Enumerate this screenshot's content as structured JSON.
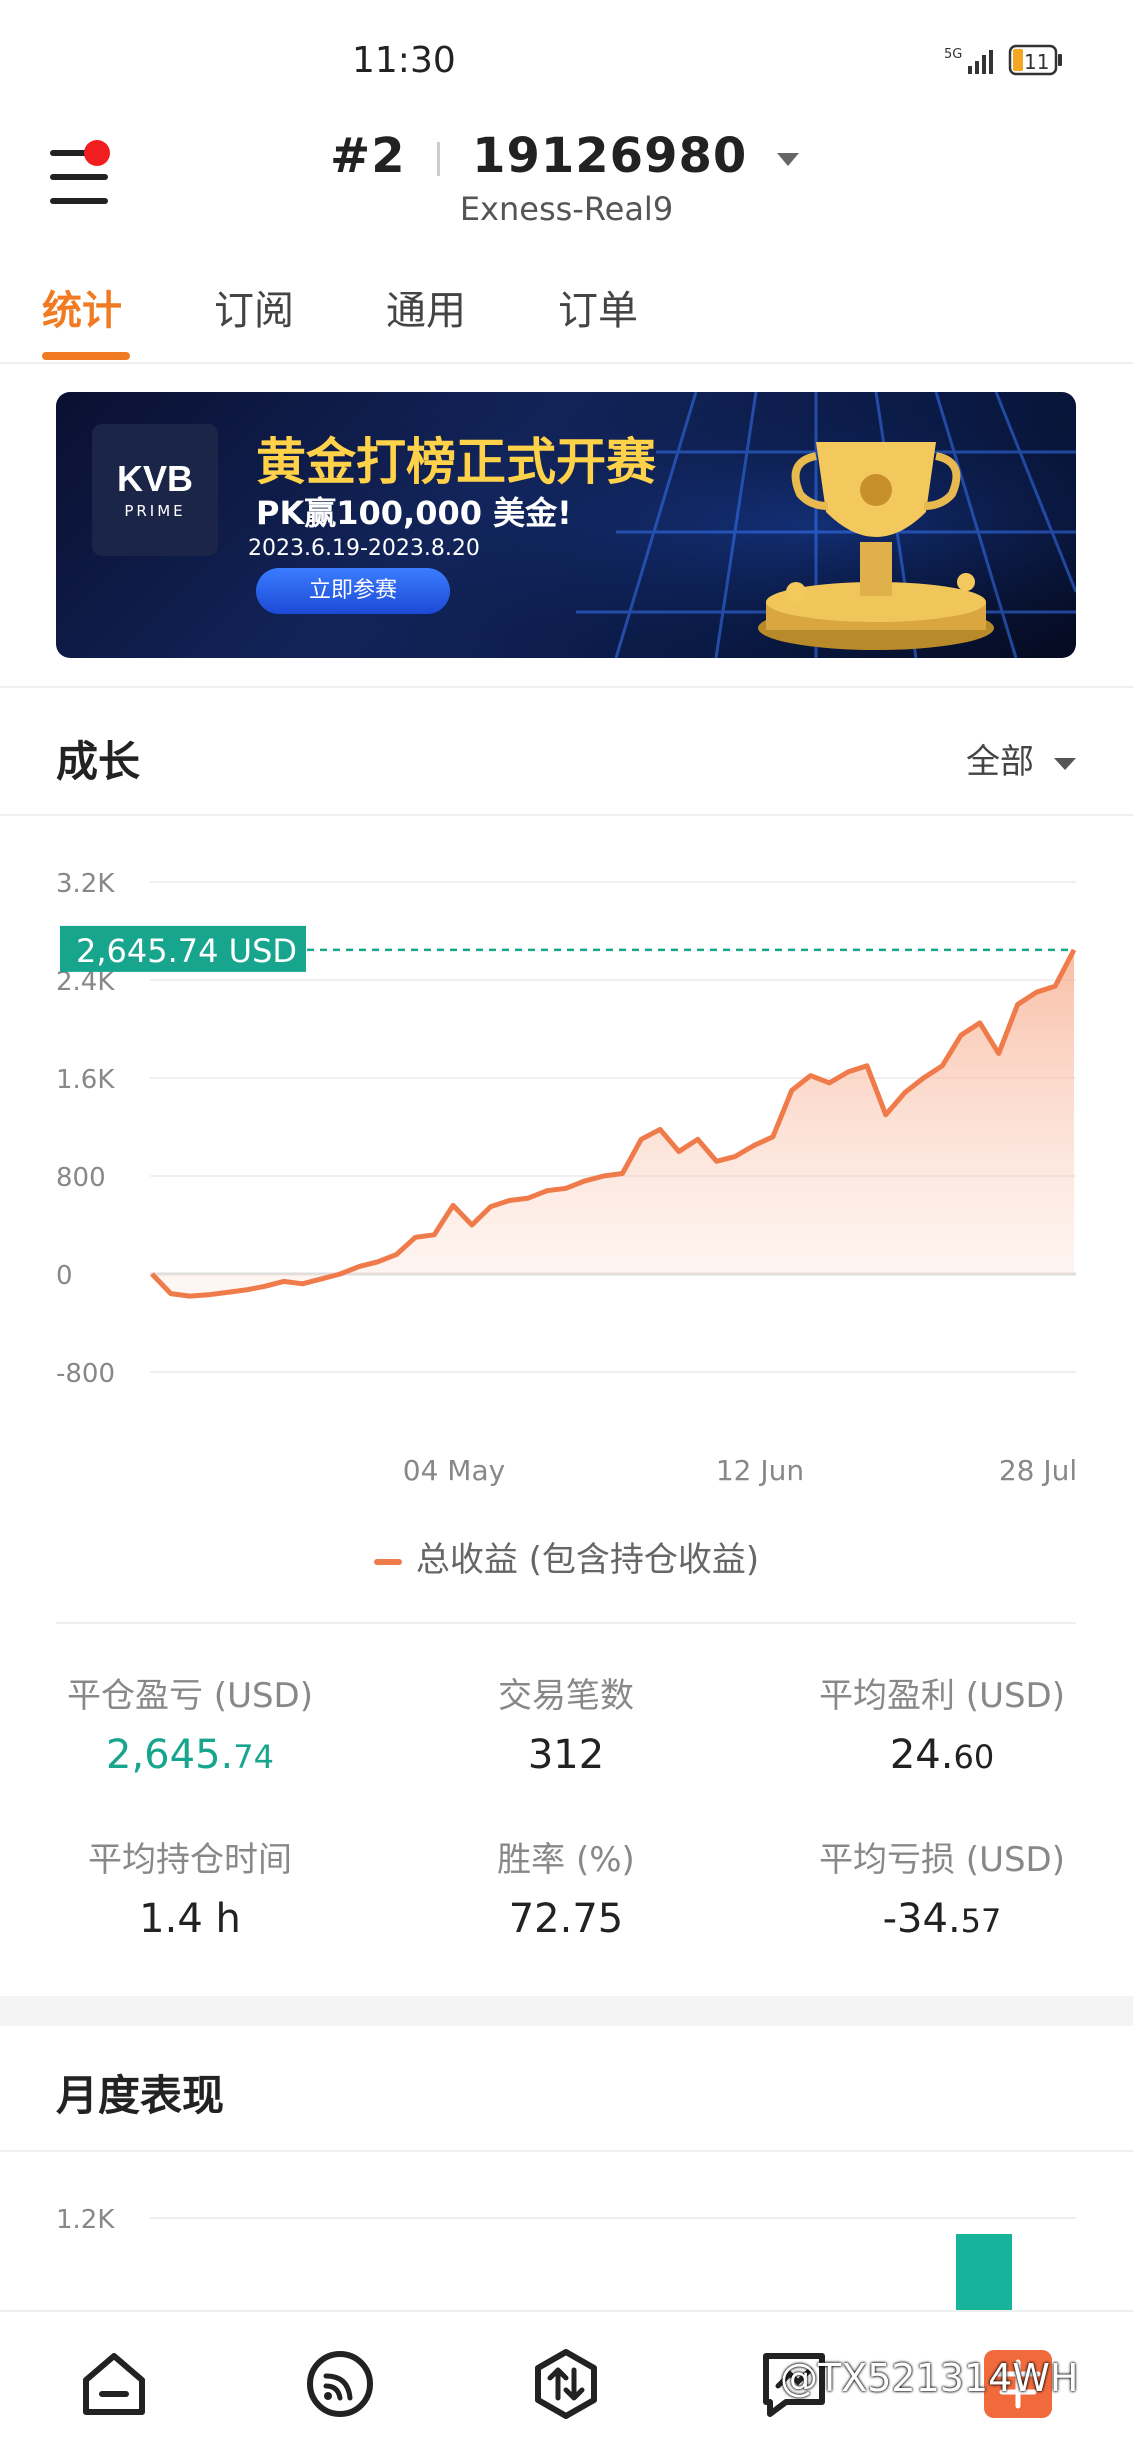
{
  "status_bar": {
    "time": "11:30",
    "network": "5G",
    "battery": "11"
  },
  "header": {
    "account_index": "#2",
    "account_number": "19126980",
    "server": "Exness-Real9"
  },
  "tabs": [
    "统计",
    "订阅",
    "通用",
    "订单"
  ],
  "banner": {
    "logo_main": "KVB",
    "logo_sub": "PRIME",
    "headline": "黄金打榜正式开赛",
    "subline": "PK赢100,000 美金!",
    "dates": "2023.6.19-2023.8.20",
    "button": "立即参赛"
  },
  "growth": {
    "title": "成长",
    "filter": "全部",
    "legend": "总收益 (包含持仓收益)"
  },
  "chart_data": {
    "type": "area",
    "ylim": [
      -800,
      3200
    ],
    "yticks": [
      "3.2K",
      "2.4K",
      "1.6K",
      "800",
      "0",
      "-800"
    ],
    "xticks": [
      "04 May",
      "12 Jun",
      "28 Jul"
    ],
    "current_label": "2,645.74 USD",
    "current_value": 2645.74,
    "series": [
      {
        "name": "总收益 (包含持仓收益)",
        "values": [
          0,
          -160,
          -180,
          -170,
          -150,
          -130,
          -100,
          -60,
          -80,
          -40,
          0,
          60,
          100,
          160,
          300,
          320,
          560,
          400,
          550,
          600,
          620,
          680,
          700,
          760,
          800,
          820,
          1100,
          1180,
          1000,
          1100,
          920,
          960,
          1050,
          1120,
          1500,
          1620,
          1560,
          1650,
          1700,
          1300,
          1480,
          1600,
          1700,
          1950,
          2050,
          1800,
          2200,
          2300,
          2350,
          2645.74
        ]
      }
    ]
  },
  "stats": [
    {
      "label": "平仓盈亏 (USD)",
      "value_main": "2,645.",
      "value_dec": "74",
      "color": "#18a58e"
    },
    {
      "label": "交易笔数",
      "value_main": "312",
      "value_dec": ""
    },
    {
      "label": "平均盈利 (USD)",
      "value_main": "24.",
      "value_dec": "60"
    },
    {
      "label": "平均持仓时间",
      "value_main": "1.4 h",
      "value_dec": ""
    },
    {
      "label": "胜率 (%)",
      "value_main": "72.75",
      "value_dec": ""
    },
    {
      "label": "平均亏损 (USD)",
      "value_main": "-34.",
      "value_dec": "57"
    }
  ],
  "monthly": {
    "title": "月度表现",
    "ytick_top": "1.2K",
    "bar_color": "#18b39b"
  },
  "bottom_nav": {
    "items": [
      "home-icon",
      "signal-icon",
      "trade-icon",
      "chat-icon",
      "profile-icon"
    ],
    "watermark": "@TX521314WH"
  },
  "colors": {
    "accent": "#f07b22",
    "positive": "#18a58e",
    "chart_line": "#f07b4a"
  }
}
